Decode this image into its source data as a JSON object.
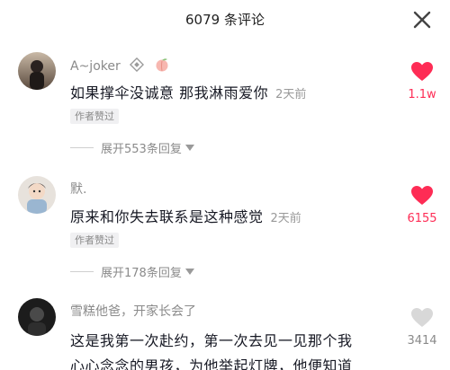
{
  "header": {
    "title": "6079 条评论"
  },
  "comments": [
    {
      "username": "A~joker",
      "text": "如果撑伞没诚意 那我淋雨爱你",
      "time": "2天前",
      "author_liked": "作者赞过",
      "expand": "展开553条回复",
      "likes": "1.1w",
      "liked": true
    },
    {
      "username": "默.",
      "text": "原来和你失去联系是这种感觉",
      "time": "2天前",
      "author_liked": "作者赞过",
      "expand": "展开178条回复",
      "likes": "6155",
      "liked": true
    },
    {
      "username": "雪糕他爸，开家长会了",
      "text_line1": "这是我第一次赴约，第一次去见一见那个我",
      "text_line2": "心心念念的男孩，为他举起灯牌，他便知道",
      "likes": "3414",
      "liked": false
    }
  ],
  "colors": {
    "like_red": "#fe2c55",
    "like_grey": "#d8d8d8",
    "text_grey": "#8a8a8a"
  },
  "icons": {
    "close": "close-icon",
    "like": "heart-icon",
    "badge1": "diamond-badge-icon",
    "badge2": "peach-badge-icon"
  }
}
